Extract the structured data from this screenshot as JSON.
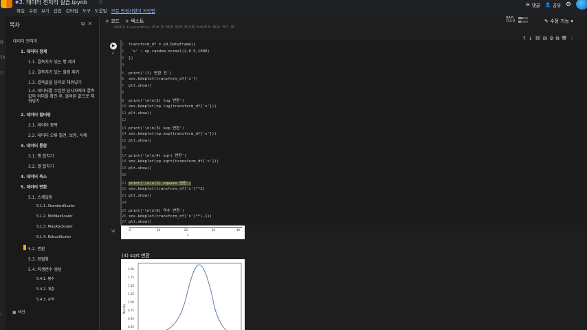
{
  "header": {
    "title": "2. 데이터 전처리 실습.ipynb",
    "menu": [
      "파일",
      "수정",
      "보기",
      "삽입",
      "런타임",
      "도구",
      "도움말",
      "모든 변경사항이 저장됨"
    ],
    "comment": "댓글",
    "share": "공유"
  },
  "toolbar": {
    "code": "+ 코드",
    "text": "+ 텍스트",
    "ram": "RAM",
    "disk": "디스크",
    "edit": "수정 가능"
  },
  "rail": [
    "Q",
    "{x}",
    "▭"
  ],
  "sidebar": {
    "title": "목차",
    "items": [
      {
        "label": "데이터 전처리",
        "level": 0
      },
      {
        "label": "1. 데이터 정제",
        "level": 1
      },
      {
        "label": "1.1. 결측치가 있는 행 제거",
        "level": 2
      },
      {
        "label": "1.2. 결측치가 있는 컬럼 제거",
        "level": 2
      },
      {
        "label": "1.3. 결측값을 임의로 채워넣기",
        "level": 2
      },
      {
        "label": "1.4. 데이터를 수집한 당사자에게 결측값의 의미를 확인 후, 올바른 값으로 채워넣기",
        "level": 2
      },
      {
        "label": "2. 데이터 필터링",
        "level": 1
      },
      {
        "label": "2.1. 데이터 중복",
        "level": 2
      },
      {
        "label": "2.2. 데이터 오류 발견, 보정, 삭제",
        "level": 2
      },
      {
        "label": "3. 데이터 통합",
        "level": 1
      },
      {
        "label": "3.1. 행 합치기",
        "level": 2
      },
      {
        "label": "3.2. 열 합치기",
        "level": 2
      },
      {
        "label": "4. 데이터 축소",
        "level": 1
      },
      {
        "label": "5. 데이터 변환",
        "level": 1
      },
      {
        "label": "5.1. 스케일링",
        "level": 2
      },
      {
        "label": "5.1.1. StandardScaler",
        "level": 3
      },
      {
        "label": "5.1.2. MinMaxScaler",
        "level": 3
      },
      {
        "label": "5.1.3. MaxAbsScaler",
        "level": 3
      },
      {
        "label": "5.1.4. RobustScaler",
        "level": 3
      },
      {
        "label": "5.2. 변환",
        "level": 2
      },
      {
        "label": "5.3. 정렬화",
        "level": 2
      },
      {
        "label": "5.4. 파생변수 생성",
        "level": 2
      },
      {
        "label": "5.4.1. 평수",
        "level": 3
      },
      {
        "label": "5.4.2. 계층",
        "level": 3
      },
      {
        "label": "5.4.3. 요약",
        "level": 3
      }
    ],
    "footer": "섹션"
  },
  "cell": {
    "truncated_header": "...데이터 Exploratory 분석 및 변환 작업 결과를 보여주는 예시 코드 셀",
    "lines": [
      "transform_df = pd.DataFrame({",
      "    'x' : np.random.normal(2,0.5,1000)",
      "})",
      "",
      "print('(1) 변환 전')",
      "sns.kdeplot(transform_df['x'])",
      "plt.show()",
      "",
      "print('\\n\\n(2) log 변환')",
      "sns.kdeplot(np.log(transform_df['x']))",
      "plt.show()",
      "",
      "print('\\n\\n(3) exp 변환')",
      "sns.kdeplot(np.exp(transform_df['x']))",
      "plt.show()",
      "",
      "print('\\n\\n(4) sqrt 변환')",
      "sns.kdeplot(np.sqrt(transform_df['x']))",
      "plt.show()",
      "",
      "print('\\n\\n(5) square 변환')",
      "sns.kdeplot(transform_df['x']**2)",
      "plt.show()",
      "",
      "print('\\n\\n(6) 역수 변환')",
      "sns.kdeplot(transform_df['x']**(-1))",
      "plt.show()"
    ]
  },
  "outputs": {
    "plot1_ticks": [
      "0",
      "10",
      "20",
      "30",
      "40"
    ],
    "plot1_xlabel": "x",
    "plot2_title": "(4) sqrt 변환",
    "plot2_yticks": [
      "2.00",
      "1.75",
      "1.50",
      "1.25",
      "1.00",
      "0.75",
      "0.50",
      "0.25"
    ],
    "plot2_ylabel": "Density"
  },
  "colors": {
    "accent": "#f9ab00",
    "link": "#8ab4f8",
    "background": "#1e1e1e"
  }
}
